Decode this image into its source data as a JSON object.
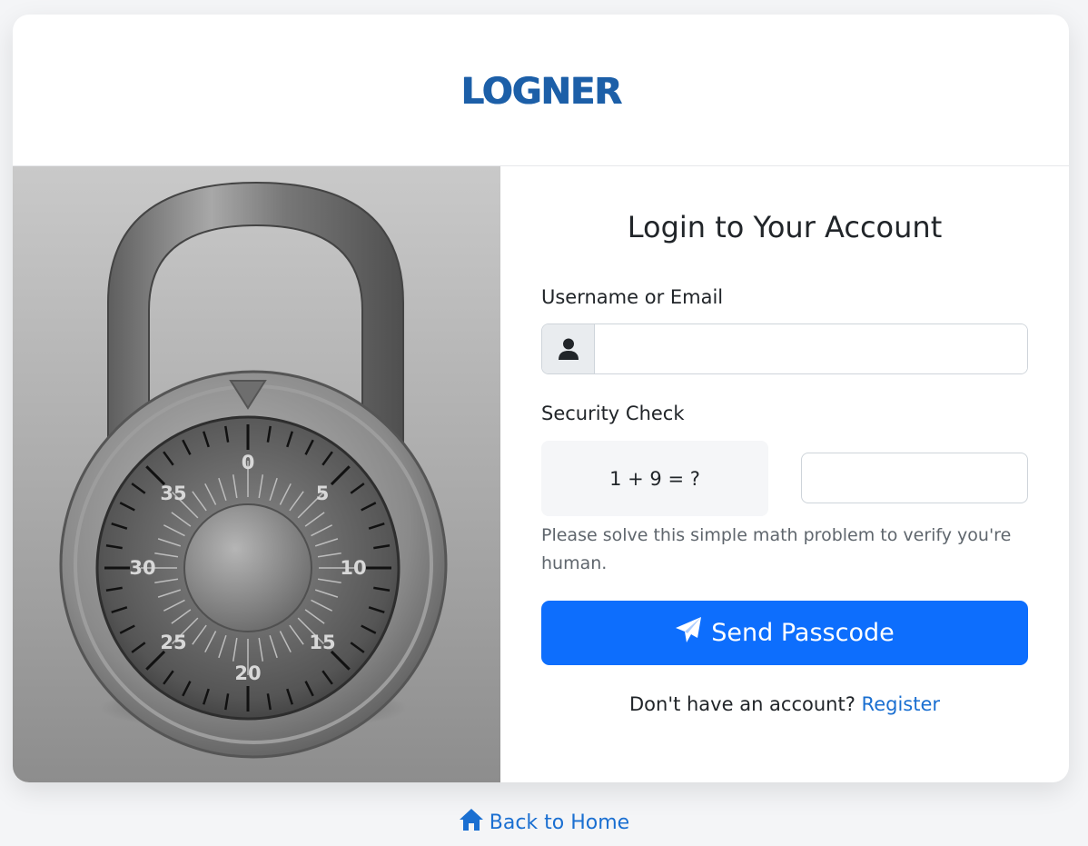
{
  "brand": {
    "logo_text": "LOGNER",
    "logo_color": "#1c5fa8"
  },
  "lock_dial": {
    "numbers": [
      "0",
      "5",
      "10",
      "15",
      "20",
      "25",
      "30",
      "35"
    ]
  },
  "form": {
    "title": "Login to Your Account",
    "username_label": "Username or Email",
    "username_value": "",
    "username_icon": "user-icon",
    "security_label": "Security Check",
    "math_question": "1 + 9 = ?",
    "answer_value": "",
    "help_text": "Please solve this simple math problem to verify you're human.",
    "submit_label": "Send Passcode",
    "submit_icon": "paper-plane-icon",
    "register_prompt": "Don't have an account?",
    "register_link": "Register"
  },
  "footer": {
    "back_home_label": "Back to Home",
    "back_home_icon": "home-icon"
  },
  "colors": {
    "primary": "#0d6efd",
    "link": "#1a6fd1",
    "page_bg": "#f4f5f7"
  }
}
